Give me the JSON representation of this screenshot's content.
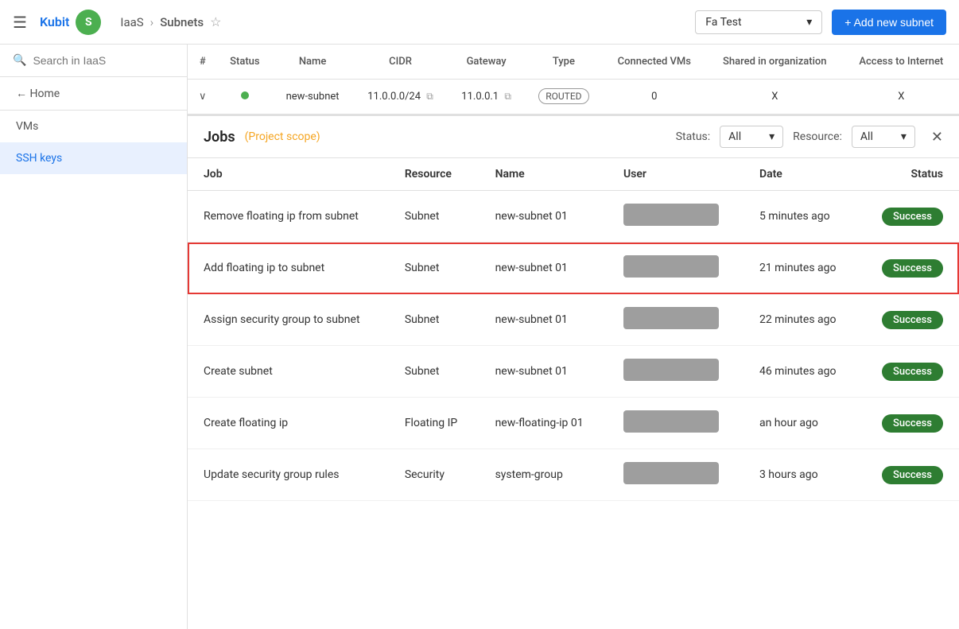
{
  "topbar": {
    "menu_icon": "☰",
    "logo_text": "Kubit",
    "logo_secondary": "S",
    "breadcrumb_parent": "IaaS",
    "breadcrumb_separator": "›",
    "breadcrumb_current": "Subnets",
    "star": "☆",
    "project_selector_label": "Fa Test",
    "chevron_down": "▾",
    "add_subnet_label": "+ Add new subnet"
  },
  "sidebar": {
    "search_placeholder": "Search in IaaS",
    "search_icon": "🔍",
    "back_label": "← Home",
    "nav_items": [
      {
        "id": "vms",
        "label": "VMs",
        "active": false
      },
      {
        "id": "ssh-keys",
        "label": "SSH keys",
        "active": false
      }
    ]
  },
  "subnets_table": {
    "columns": [
      "#",
      "Status",
      "Name",
      "CIDR",
      "Gateway",
      "Type",
      "Connected VMs",
      "Shared in organization",
      "Access to Internet"
    ],
    "row": {
      "chevron": "∨",
      "status_dot": "●",
      "name": "new-subnet",
      "cidr": "11.0.0.0/24",
      "gateway": "11.0.0.1",
      "type": "ROUTED",
      "connected_vms": "0",
      "shared_in_org": "x",
      "access_internet": "x"
    }
  },
  "jobs": {
    "title": "Jobs",
    "scope": "(Project scope)",
    "status_label": "Status:",
    "status_value": "All",
    "resource_label": "Resource:",
    "resource_value": "All",
    "close_icon": "✕",
    "columns": {
      "job": "Job",
      "resource": "Resource",
      "name": "Name",
      "user": "User",
      "date": "Date",
      "status": "Status"
    },
    "rows": [
      {
        "id": "row-1",
        "job": "Remove floating ip from subnet",
        "resource": "Subnet",
        "name": "new-subnet 01",
        "user_redacted": true,
        "date": "5 minutes ago",
        "status": "Success",
        "highlighted": false
      },
      {
        "id": "row-2",
        "job": "Add floating ip to subnet",
        "resource": "Subnet",
        "name": "new-subnet 01",
        "user_redacted": true,
        "date": "21 minutes ago",
        "status": "Success",
        "highlighted": true
      },
      {
        "id": "row-3",
        "job": "Assign security group to subnet",
        "resource": "Subnet",
        "name": "new-subnet 01",
        "user_redacted": true,
        "date": "22 minutes ago",
        "status": "Success",
        "highlighted": false
      },
      {
        "id": "row-4",
        "job": "Create subnet",
        "resource": "Subnet",
        "name": "new-subnet 01",
        "user_redacted": true,
        "date": "46 minutes ago",
        "status": "Success",
        "highlighted": false
      },
      {
        "id": "row-5",
        "job": "Create floating ip",
        "resource": "Floating IP",
        "name": "new-floating-ip 01",
        "user_redacted": true,
        "date": "an hour ago",
        "status": "Success",
        "highlighted": false
      },
      {
        "id": "row-6",
        "job": "Update security group rules",
        "resource": "Security",
        "name": "system-group",
        "user_redacted": true,
        "date": "3 hours ago",
        "status": "Success",
        "highlighted": false
      }
    ]
  }
}
